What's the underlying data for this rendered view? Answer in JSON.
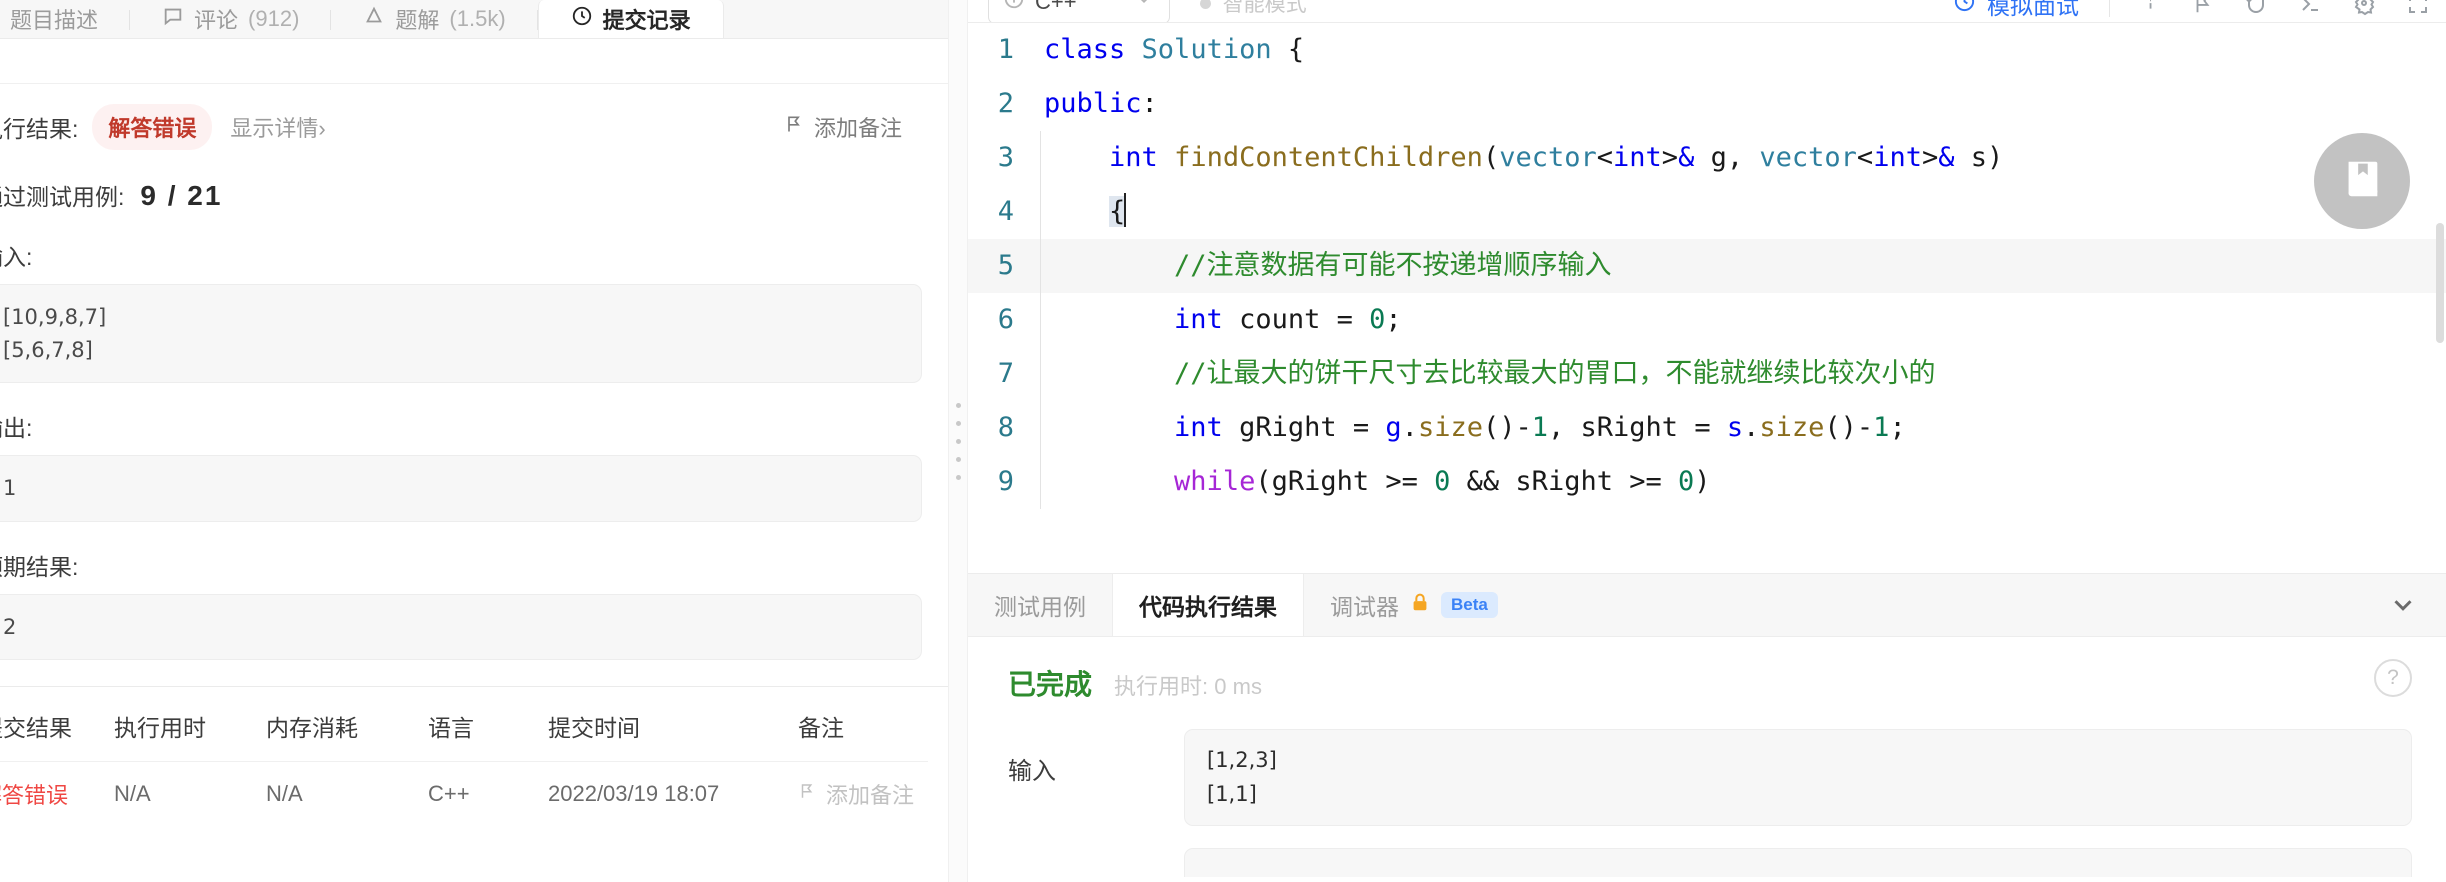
{
  "left": {
    "tabs": [
      {
        "label": "题目描述",
        "icon": "doc-icon",
        "count": "",
        "active": false
      },
      {
        "label": "评论",
        "icon": "comment-icon",
        "count": "(912)",
        "active": false
      },
      {
        "label": "题解",
        "icon": "bulb-icon",
        "count": "(1.5k)",
        "active": false
      },
      {
        "label": "提交记录",
        "icon": "clock-icon",
        "count": "",
        "active": true
      }
    ],
    "result": {
      "label": "执行结果:",
      "status": "解答错误",
      "detail_link": "显示详情",
      "detail_chevron": "›",
      "add_note": "添加备注",
      "pass_label": "通过测试用例:",
      "pass_value": "9 / 21",
      "input_label": "输入:",
      "input_lines": [
        "[10,9,8,7]",
        "[5,6,7,8]"
      ],
      "output_label": "输出:",
      "output_lines": [
        "1"
      ],
      "expected_label": "预期结果:",
      "expected_lines": [
        "2"
      ]
    },
    "table": {
      "headers": [
        "提交结果",
        "执行用时",
        "内存消耗",
        "语言",
        "提交时间",
        "备注"
      ],
      "rows": [
        {
          "result": "解答错误",
          "runtime": "N/A",
          "memory": "N/A",
          "language": "C++",
          "time": "2022/03/19 18:07",
          "note": "添加备注"
        }
      ]
    }
  },
  "toolbar": {
    "language": "C++",
    "language_icon": "info-circle-icon",
    "chevron": "chevron-down-icon",
    "smart_mode": "智能模式",
    "mock_interview": "模拟面试",
    "icons": [
      "info-icon",
      "flag-icon",
      "reset-icon",
      "console-icon",
      "settings-icon",
      "fullscreen-icon"
    ]
  },
  "editor": {
    "lines": [
      {
        "n": "1",
        "text": "class Solution {"
      },
      {
        "n": "2",
        "text": "public:"
      },
      {
        "n": "3",
        "text": "    int findContentChildren(vector<int>& g, vector<int>& s)"
      },
      {
        "n": "4",
        "text": "    {"
      },
      {
        "n": "5",
        "text": "        //注意数据有可能不按递增顺序输入"
      },
      {
        "n": "6",
        "text": "        int count = 0;"
      },
      {
        "n": "7",
        "text": "        //让最大的饼干尺寸去比较最大的胃口，不能就继续比较次小的"
      },
      {
        "n": "8",
        "text": "        int gRight = g.size()-1, sRight = s.size()-1;"
      },
      {
        "n": "9",
        "text": "        while(gRight >= 0 && sRight >= 0)"
      }
    ],
    "fab_icon": "book-bookmark-icon"
  },
  "console": {
    "tabs": [
      {
        "label": "测试用例",
        "active": false,
        "lock": false,
        "beta": ""
      },
      {
        "label": "代码执行结果",
        "active": true,
        "lock": false,
        "beta": ""
      },
      {
        "label": "调试器",
        "active": false,
        "lock": true,
        "beta": "Beta"
      }
    ],
    "collapse_icon": "chevron-down-icon",
    "status": "已完成",
    "runtime_label": "执行用时:",
    "runtime_value": "0 ms",
    "help_icon": "?",
    "input_label": "输入",
    "input_lines": [
      "[1,2,3]",
      "[1,1]"
    ]
  },
  "colors": {
    "accent_blue": "#2f73f5",
    "error_red": "#c0392b",
    "success_green": "#2e8b2e",
    "beta_blue": "#3b82f6"
  }
}
